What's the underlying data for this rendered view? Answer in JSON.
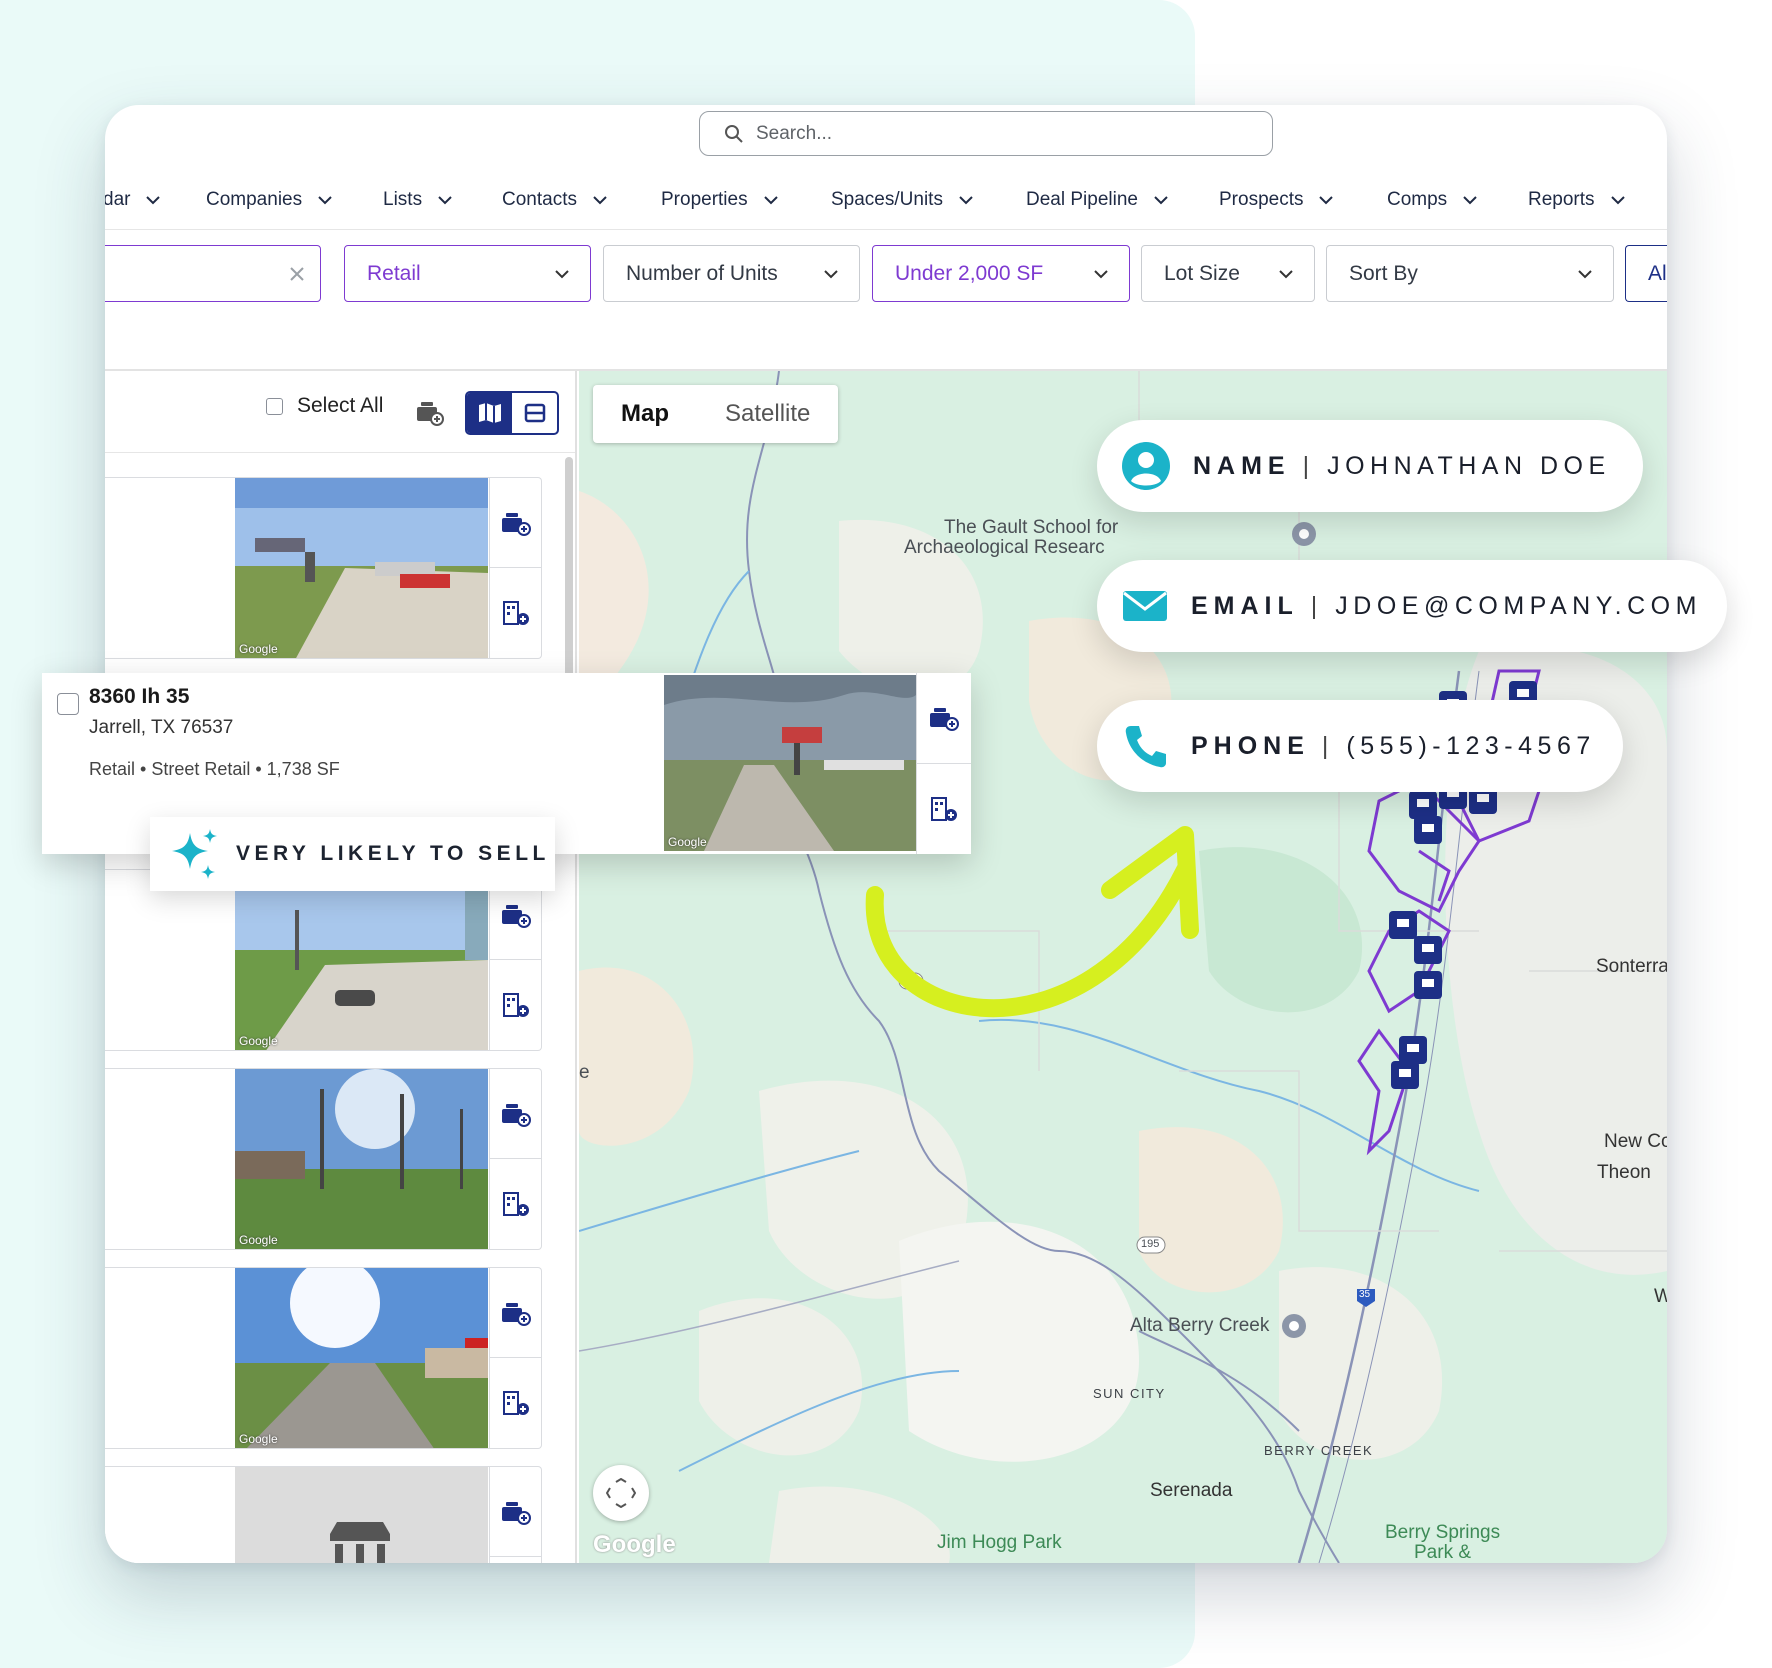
{
  "search": {
    "placeholder": "Search..."
  },
  "nav": {
    "items": [
      {
        "label": "dar"
      },
      {
        "label": "Companies"
      },
      {
        "label": "Lists"
      },
      {
        "label": "Contacts"
      },
      {
        "label": "Properties"
      },
      {
        "label": "Spaces/Units"
      },
      {
        "label": "Deal Pipeline"
      },
      {
        "label": "Prospects"
      },
      {
        "label": "Comps"
      },
      {
        "label": "Reports"
      }
    ]
  },
  "filters": {
    "keyword_value": "",
    "property_type": "Retail",
    "units": "Number of Units",
    "size": "Under 2,000 SF",
    "lot_size": "Lot Size",
    "sort_by": "Sort By",
    "truncated": "Al"
  },
  "list": {
    "select_all": "Select All"
  },
  "detail": {
    "address": "8360 Ih 35",
    "city": "Jarrell, TX 76537",
    "meta": "Retail • Street Retail • 1,738 SF",
    "badge": "VERY LIKELY TO SELL"
  },
  "map": {
    "tab_map": "Map",
    "tab_satellite": "Satellite",
    "labels": {
      "gault": "The Gault School for",
      "gault2": "Archaeological Researc",
      "sonterra": "Sonterra",
      "new_co": "New Co",
      "theon": "Theon",
      "alta": "Alta Berry Creek",
      "sun_city": "SUN CITY",
      "berry_creek": "BERRY CREEK",
      "serenada": "Serenada",
      "jim_hogg": "Jim Hogg Park",
      "berry_springs": "Berry Springs",
      "berry_springs2": "Park &",
      "w": "W",
      "e": "e",
      "r195a": "195",
      "r195b": "195",
      "i35": "35",
      "i35b": "35"
    },
    "logo": "Google"
  },
  "contact": {
    "name_label": "NAME",
    "name_value": "JOHNATHAN DOE",
    "email_label": "EMAIL",
    "email_value": "JDOE@COMPANY.COM",
    "phone_label": "PHONE",
    "phone_value": "(555)-123-4567",
    "divider": "|"
  },
  "colors": {
    "brand_navy": "#1d2f86",
    "purple": "#7e3ad1",
    "teal": "#1bb3c9",
    "lime_arrow": "#d6ef1f"
  }
}
